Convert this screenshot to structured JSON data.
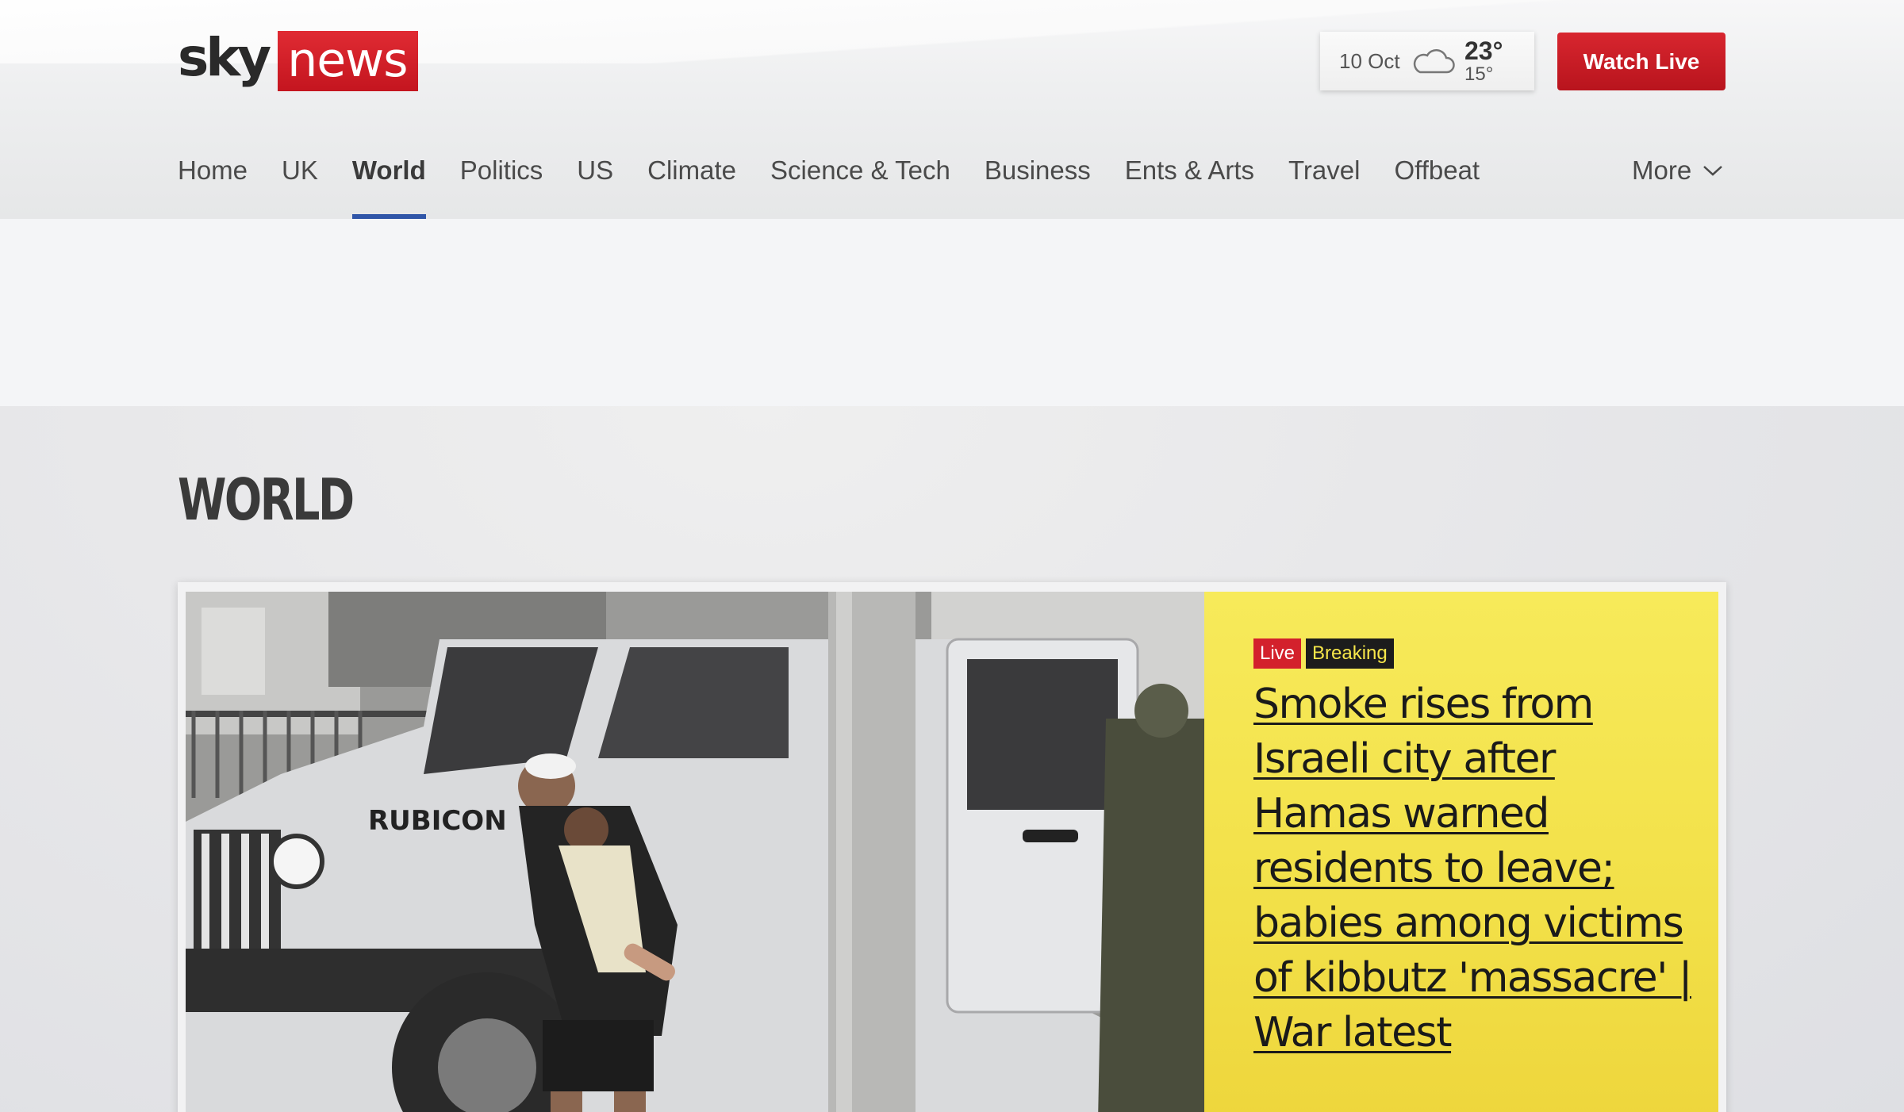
{
  "header": {
    "logo": {
      "sky": "sky",
      "news": "news"
    },
    "weather": {
      "date": "10 Oct",
      "high": "23°",
      "low": "15°",
      "icon": "cloud-icon"
    },
    "watch_live": "Watch Live"
  },
  "nav": {
    "items": [
      {
        "label": "Home"
      },
      {
        "label": "UK"
      },
      {
        "label": "World",
        "active": true
      },
      {
        "label": "Politics"
      },
      {
        "label": "US"
      },
      {
        "label": "Climate"
      },
      {
        "label": "Science & Tech"
      },
      {
        "label": "Business"
      },
      {
        "label": "Ents & Arts"
      },
      {
        "label": "Travel"
      },
      {
        "label": "Offbeat"
      }
    ],
    "more": "More"
  },
  "section": {
    "title": "WORLD"
  },
  "hero": {
    "badge_live": "Live",
    "badge_breaking": "Breaking",
    "headline": "Smoke rises from Israeli city after Hamas warned residents to leave; babies among victims of kibbutz 'massacre' | War latest",
    "vehicle_badge": "RUBICON"
  },
  "colors": {
    "brand_red": "#d3212c",
    "nav_active_underline": "#3056a8",
    "panel_yellow": "#f2e048"
  }
}
